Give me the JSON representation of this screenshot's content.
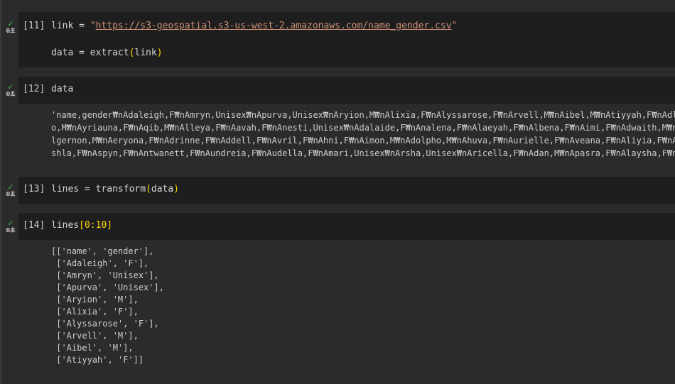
{
  "cells": [
    {
      "count": "[11]",
      "status": {
        "icon": "check-icon",
        "time": "0초"
      },
      "code": {
        "line1_var": "link = ",
        "line1_quote_open": "\"",
        "line1_url": "https://s3-geospatial.s3-us-west-2.amazonaws.com/name_gender.csv",
        "line1_quote_close": "\"",
        "line2_prefix": "data = extract",
        "line2_paren_open": "(",
        "line2_arg": "link",
        "line2_paren_close": ")"
      }
    },
    {
      "count": "[12]",
      "status": {
        "icon": "check-icon",
        "time": "0초"
      },
      "code": {
        "line1": "data"
      },
      "output": [
        "'name,gender₩nAdaleigh,F₩nAmryn,Unisex₩nApurva,Unisex₩nAryion,M₩nAlixia,F₩nAlyssarose,F₩nArvell,M₩nAibel,M₩nAtiyyah,F₩nAdlie,F",
        "o,M₩nAyriauna,F₩nAqib,M₩nAlleya,F₩nAavah,F₩nAnesti,Unisex₩nAdalaide,F₩nAnalena,F₩nAlaeyah,F₩nAlbena,F₩nAimi,F₩nAdwaith,M₩nArka",
        "lgernon,M₩nAeryona,F₩nAdrinne,F₩nAddell,F₩nAvril,F₩nAhni,F₩nAimon,M₩nAdolpho,M₩nAhuva,F₩nAurielle,F₩nAveana,F₩nAliyia,F₩nAlesa",
        "shla,F₩nAspyn,F₩nAntwanett,F₩nAundreia,F₩nAudella,F₩nAmari,Unisex₩nArsha,Unisex₩nAricella,F₩nAdan,M₩nApasra,F₩nAlaysha,F₩nAnde"
      ]
    },
    {
      "count": "[13]",
      "status": {
        "icon": "check-icon",
        "time": "0초"
      },
      "code": {
        "line1_prefix": "lines = transform",
        "line1_paren_open": "(",
        "line1_arg": "data",
        "line1_paren_close": ")"
      }
    },
    {
      "count": "[14]",
      "status": {
        "icon": "check-icon",
        "time": "0초"
      },
      "code": {
        "line1_prefix": "lines",
        "line1_bracket": "[0:10]"
      },
      "output": [
        "[['name', 'gender'],",
        " ['Adaleigh', 'F'],",
        " ['Amryn', 'Unisex'],",
        " ['Apurva', 'Unisex'],",
        " ['Aryion', 'M'],",
        " ['Alixia', 'F'],",
        " ['Alyssarose', 'F'],",
        " ['Arvell', 'M'],",
        " ['Aibel', 'M'],",
        " ['Atiyyah', 'F']]"
      ]
    }
  ]
}
